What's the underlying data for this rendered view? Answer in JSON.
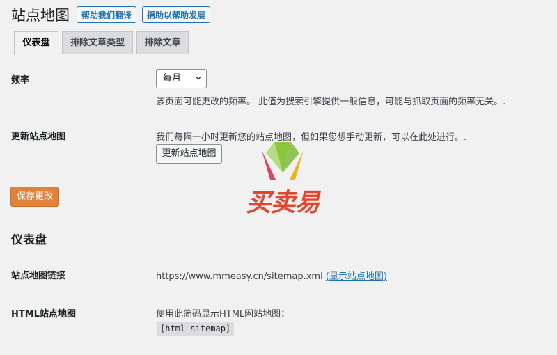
{
  "header": {
    "title": "站点地图",
    "help_translate": "帮助我们翻译",
    "donate": "捐助以帮助发展"
  },
  "tabs": [
    {
      "label": "仪表盘",
      "active": true
    },
    {
      "label": "排除文章类型",
      "active": false
    },
    {
      "label": "排除文章",
      "active": false
    }
  ],
  "settings": {
    "frequency": {
      "label": "频率",
      "selected": "每月",
      "description": "该页面可能更改的频率。 此值为搜索引擎提供一般信息，可能与抓取页面的频率无关。."
    },
    "update_sitemap": {
      "label": "更新站点地图",
      "description": "我们每隔一小时更新您的站点地图，但如果您想手动更新，可以在此处进行。.",
      "button": "更新站点地图"
    },
    "save_button": "保存更改"
  },
  "dashboard": {
    "title": "仪表盘",
    "sitemap_link": {
      "label": "站点地图链接",
      "url": "https://www.mmeasy.cn/sitemap.xml",
      "link_text": "(显示站点地图)"
    },
    "html_sitemap": {
      "label": "HTML站点地图",
      "description": "使用此简码显示HTML网站地图：",
      "shortcode": "[html-sitemap]"
    }
  },
  "watermark": {
    "text": "买卖易"
  },
  "colors": {
    "accent": "#2271b1",
    "save_button": "#e0823b",
    "watermark_red": "#e2462e"
  }
}
